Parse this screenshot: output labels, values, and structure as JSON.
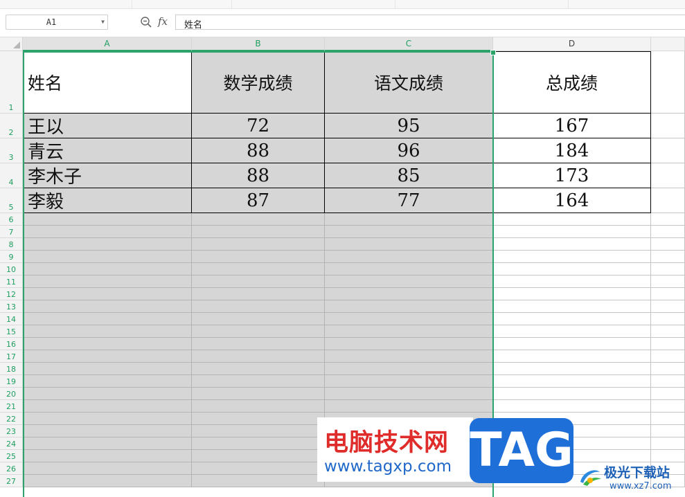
{
  "formula_bar": {
    "cell_ref": "A1",
    "value": "姓名",
    "icons": [
      "zoom-icon",
      "fx-icon",
      "dropdown-caret-icon"
    ]
  },
  "sheet": {
    "columns": [
      "A",
      "B",
      "C",
      "D"
    ],
    "rows": [
      "1",
      "2",
      "3",
      "4",
      "5",
      "6",
      "7",
      "8",
      "9",
      "10",
      "11",
      "12",
      "13",
      "14",
      "15",
      "16",
      "17",
      "18",
      "19",
      "20",
      "21",
      "22",
      "23",
      "24",
      "25",
      "26",
      "27"
    ],
    "headers": [
      "姓名",
      "数学成绩",
      "语文成绩",
      "总成绩"
    ],
    "data": [
      [
        "王以",
        "72",
        "95",
        "167"
      ],
      [
        "青云",
        "88",
        "96",
        "184"
      ],
      [
        "李木子",
        "88",
        "85",
        "173"
      ],
      [
        "李毅",
        "87",
        "77",
        "164"
      ]
    ],
    "selection": "A:C",
    "selection_color": "#2ba36a"
  },
  "watermarks": {
    "site_name": "电脑技术网",
    "site_url": "www.tagxp.com",
    "tag": "TAG",
    "logo_name": "极光下载站",
    "logo_url": "www.xz7.com"
  }
}
